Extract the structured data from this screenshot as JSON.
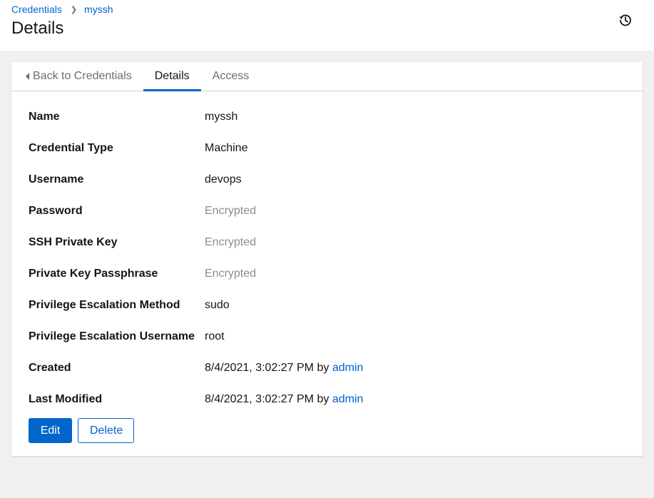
{
  "breadcrumb": {
    "parent": "Credentials",
    "current": "myssh"
  },
  "header": {
    "title": "Details",
    "history_icon": "history-icon"
  },
  "tabs": [
    {
      "label": "Back to Credentials",
      "active": false
    },
    {
      "label": "Details",
      "active": true
    },
    {
      "label": "Access",
      "active": false
    }
  ],
  "details": {
    "name": {
      "label": "Name",
      "value": "myssh"
    },
    "credential_type": {
      "label": "Credential Type",
      "value": "Machine"
    },
    "username": {
      "label": "Username",
      "value": "devops"
    },
    "password": {
      "label": "Password",
      "value": "Encrypted"
    },
    "ssh_private_key": {
      "label": "SSH Private Key",
      "value": "Encrypted"
    },
    "private_key_passphrase": {
      "label": "Private Key Passphrase",
      "value": "Encrypted"
    },
    "privilege_escalation_method": {
      "label": "Privilege Escalation Method",
      "value": "sudo"
    },
    "privilege_escalation_username": {
      "label": "Privilege Escalation Username",
      "value": "root"
    },
    "created": {
      "label": "Created",
      "date": "8/4/2021, 3:02:27 PM",
      "by": "by",
      "user": "admin"
    },
    "last_modified": {
      "label": "Last Modified",
      "date": "8/4/2021, 3:02:27 PM",
      "by": "by",
      "user": "admin"
    }
  },
  "actions": {
    "edit": "Edit",
    "delete": "Delete"
  },
  "colors": {
    "accent": "#0066cc",
    "muted": "#8a8d90",
    "background": "#f0f0f0"
  }
}
